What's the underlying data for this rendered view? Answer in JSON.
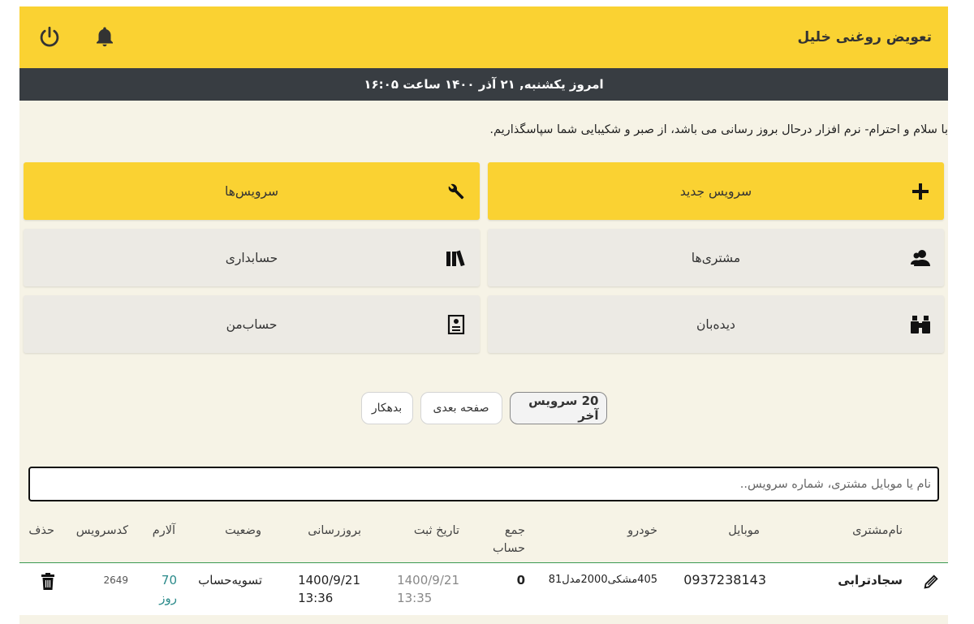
{
  "header": {
    "title": "تعویض روغنی خلیل",
    "icons": [
      "bell-icon",
      "power-icon"
    ]
  },
  "datebar": {
    "text": "امروز یکشنبه, ۲۱ آذر ۱۴۰۰ ساعت ۱۶:۰۵"
  },
  "notice": {
    "text": "با سلام و احترام- نرم افزار درحال بروز رسانی می باشد، از صبر و شکیبایی شما سپاسگذاریم."
  },
  "tiles": [
    {
      "label": "سرویس جدید",
      "icon": "plus-icon",
      "color": "#fad232"
    },
    {
      "label": "سرویس‌ها",
      "icon": "wrench-icon",
      "color": "#fad232"
    },
    {
      "label": "مشتری‌ها",
      "icon": "users-icon",
      "color": "#eceae4"
    },
    {
      "label": "حسابداری",
      "icon": "books-icon",
      "color": "#eceae4"
    },
    {
      "label": "دیده‌بان",
      "icon": "binoculars-icon",
      "color": "#eceae4"
    },
    {
      "label": "حساب‌من",
      "icon": "id-card-icon",
      "color": "#eceae4"
    }
  ],
  "filters": {
    "last20": "20 سرویس آخر",
    "next_page": "صفحه بعدی",
    "debtors": "بدهکار"
  },
  "search": {
    "placeholder": "نام یا موبایل مشتری، شماره سرویس..",
    "value": ""
  },
  "table": {
    "headers": {
      "customer": "نام‌مشتری",
      "mobile": "موبایل",
      "car": "خودرو",
      "total_line1": "جمع",
      "total_line2": "حساب",
      "registered": "تاریخ ثبت",
      "updated": "بروزرسانی",
      "status": "وضعیت",
      "alarm": "آلارم",
      "code": "کدسرویس",
      "delete": "حذف"
    },
    "rows": [
      {
        "customer": "سجادترابی",
        "mobile": "0937238143",
        "car": "405مشکی2000مدل81",
        "total": "0",
        "registered_date": "1400/9/21",
        "registered_time": "13:35",
        "updated_date": "1400/9/21",
        "updated_time": "13:36",
        "status": "تسویه‌حساب",
        "alarm_value": "70",
        "alarm_unit": "روز",
        "code": "2649"
      }
    ]
  },
  "colors": {
    "accent": "#fad232",
    "dark": "#383d42",
    "background": "#f6f3e6",
    "divider": "#3a9a52"
  }
}
